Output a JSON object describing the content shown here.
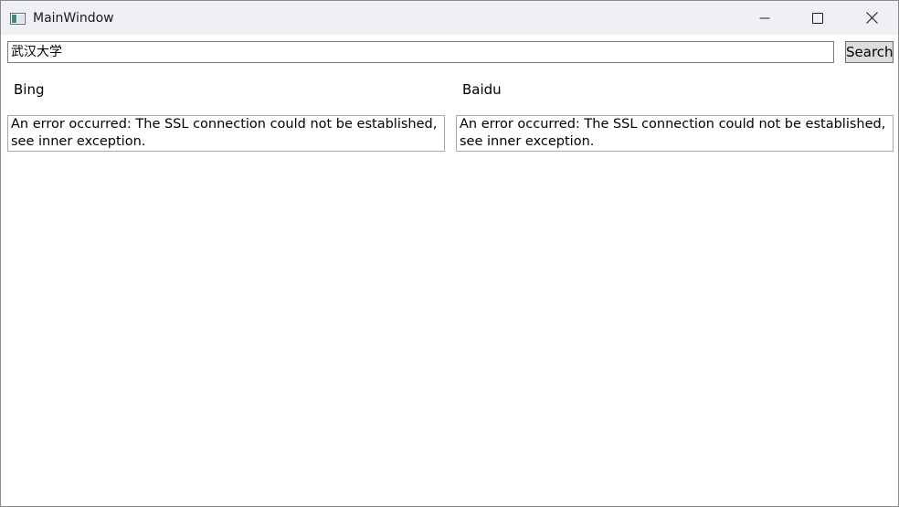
{
  "window": {
    "title": "MainWindow",
    "icon": "app-window-icon",
    "controls": {
      "minimize_icon": "minimize-icon",
      "maximize_icon": "maximize-icon",
      "close_icon": "close-icon"
    }
  },
  "search": {
    "value": "武汉大学",
    "button_label": "Search"
  },
  "results": [
    {
      "engine": "Bing",
      "text": "An error occurred: The SSL connection could not be established, see inner exception."
    },
    {
      "engine": "Baidu",
      "text": "An error occurred: The SSL connection could not be established, see inner exception."
    }
  ],
  "colors": {
    "titlebar_bg": "#eef0f6",
    "button_bg": "#dddddd",
    "border": "#7a7a7a"
  }
}
